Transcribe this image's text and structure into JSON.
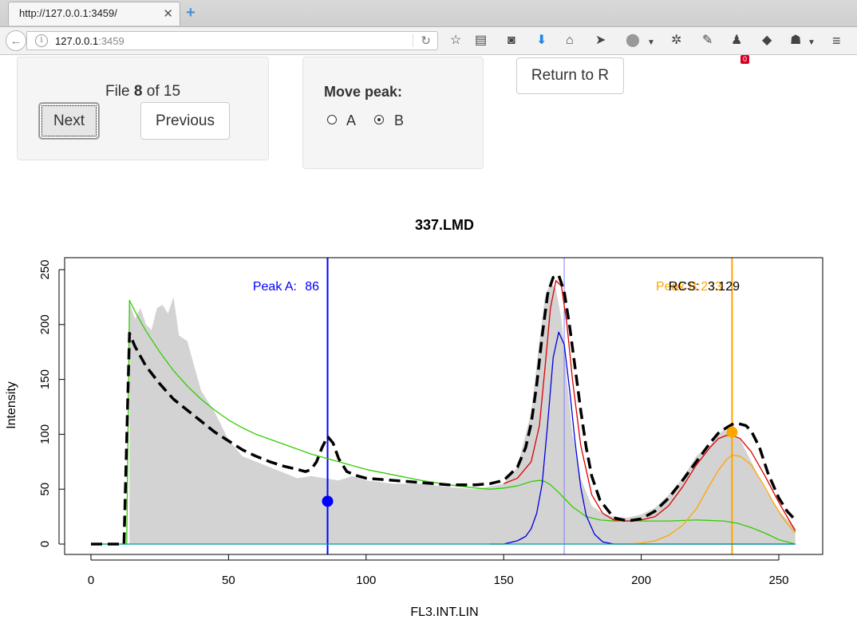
{
  "browser": {
    "tab_title": "http://127.0.0.1:3459/",
    "url_host": "127.0.0.1",
    "url_port": ":3459",
    "notification_count": "0"
  },
  "controls": {
    "file_prefix": "File ",
    "file_current": "8",
    "file_middle": " of ",
    "file_total": "15",
    "next_label": "Next",
    "previous_label": "Previous",
    "move_peak_label": "Move peak:",
    "options": [
      "A",
      "B"
    ],
    "selected_option": "B",
    "return_label": "Return to R"
  },
  "chart_data": {
    "type": "line",
    "title": "337.LMD",
    "xlabel": "FL3.INT.LIN",
    "ylabel": "Intensity",
    "xlim": [
      0,
      256
    ],
    "ylim": [
      0,
      250
    ],
    "xticks": [
      0,
      50,
      100,
      150,
      200,
      250
    ],
    "yticks": [
      0,
      50,
      100,
      150,
      200,
      250
    ],
    "annotations": {
      "peak_a_label": "Peak A:",
      "peak_a_value": "86",
      "peak_b_label": "Peak B:",
      "peak_b_value": "233",
      "rcs_label": "RCS:",
      "rcs_value": "3.129"
    },
    "markers": [
      {
        "name": "Peak A",
        "x": 86,
        "y": 39,
        "color": "#0000ff"
      },
      {
        "name": "Peak B",
        "x": 233,
        "y": 102,
        "color": "#ffa500"
      }
    ],
    "vlines": [
      {
        "x": 86,
        "color": "#0000ff"
      },
      {
        "x": 172,
        "color": "#8080ff"
      },
      {
        "x": 233,
        "color": "#ffa500"
      }
    ],
    "histogram": {
      "color": "#d3d3d3",
      "x": [
        14,
        16,
        18,
        20,
        22,
        24,
        26,
        28,
        30,
        32,
        35,
        40,
        45,
        50,
        55,
        60,
        65,
        70,
        75,
        80,
        85,
        90,
        95,
        100,
        110,
        120,
        130,
        140,
        150,
        155,
        160,
        163,
        165,
        167,
        169,
        171,
        173,
        175,
        178,
        182,
        186,
        190,
        195,
        200,
        205,
        210,
        215,
        220,
        225,
        228,
        230,
        233,
        236,
        240,
        245,
        250,
        256
      ],
      "y": [
        220,
        205,
        215,
        200,
        195,
        215,
        218,
        210,
        225,
        190,
        185,
        140,
        120,
        95,
        80,
        75,
        70,
        65,
        60,
        62,
        60,
        58,
        62,
        58,
        55,
        55,
        52,
        50,
        55,
        70,
        120,
        185,
        225,
        238,
        232,
        205,
        150,
        100,
        60,
        35,
        28,
        25,
        24,
        27,
        33,
        45,
        60,
        80,
        90,
        100,
        104,
        98,
        95,
        75,
        50,
        30,
        15
      ]
    },
    "series": [
      {
        "name": "",
        "color": "#000000",
        "dash": true,
        "x": [
          0,
          12,
          14,
          16,
          20,
          25,
          30,
          35,
          40,
          45,
          50,
          55,
          60,
          65,
          70,
          75,
          78,
          80,
          82,
          84,
          86,
          88,
          90,
          93,
          97,
          100,
          110,
          120,
          130,
          140,
          145,
          150,
          155,
          158,
          160,
          162,
          164,
          166,
          168,
          170,
          172,
          174,
          176,
          178,
          180,
          182,
          185,
          190,
          195,
          200,
          205,
          210,
          215,
          220,
          225,
          228,
          231,
          233,
          235,
          238,
          240,
          243,
          246,
          250,
          253,
          256
        ],
        "y": [
          0,
          0,
          192,
          180,
          162,
          146,
          132,
          122,
          112,
          102,
          94,
          86,
          80,
          75,
          71,
          68,
          66,
          68,
          75,
          88,
          98,
          92,
          78,
          66,
          62,
          60,
          58,
          56,
          54,
          54,
          55,
          58,
          70,
          88,
          110,
          145,
          190,
          228,
          243,
          245,
          230,
          198,
          160,
          122,
          88,
          62,
          40,
          24,
          21,
          23,
          30,
          42,
          58,
          75,
          92,
          101,
          106,
          109,
          110,
          108,
          103,
          88,
          65,
          42,
          30,
          22
        ]
      },
      {
        "name": "",
        "color": "#33cc00",
        "dash": false,
        "x": [
          0,
          12,
          13,
          14,
          16,
          20,
          25,
          30,
          35,
          40,
          45,
          50,
          55,
          60,
          70,
          80,
          90,
          100,
          110,
          120,
          130,
          140,
          145,
          150,
          155,
          160,
          163,
          165,
          167,
          170,
          175,
          180,
          185,
          190,
          200,
          210,
          220,
          230,
          235,
          240,
          245,
          250,
          256
        ],
        "y": [
          0,
          0,
          0,
          222,
          212,
          194,
          175,
          158,
          144,
          132,
          122,
          113,
          106,
          100,
          91,
          82,
          75,
          68,
          63,
          58,
          54,
          51,
          50,
          51,
          53,
          57,
          58,
          57,
          54,
          47,
          34,
          25,
          22,
          21,
          21,
          21,
          22,
          21,
          19,
          15,
          10,
          4,
          0
        ],
        "comment_none": ""
      },
      {
        "name": "",
        "color": "#dd0000",
        "dash": false,
        "x": [
          150,
          155,
          160,
          163,
          165,
          167,
          169,
          171,
          173,
          175,
          178,
          182,
          186,
          190,
          195,
          200,
          205,
          210,
          215,
          220,
          225,
          228,
          231,
          233,
          236,
          240,
          245,
          250,
          256
        ],
        "y": [
          55,
          60,
          75,
          108,
          160,
          215,
          240,
          235,
          200,
          150,
          90,
          45,
          28,
          22,
          21,
          22,
          25,
          35,
          52,
          72,
          88,
          96,
          99,
          99,
          96,
          84,
          62,
          38,
          12
        ]
      },
      {
        "name": "",
        "color": "#0000dd",
        "dash": false,
        "x": [
          145,
          150,
          155,
          158,
          160,
          162,
          164,
          166,
          168,
          170,
          172,
          174,
          176,
          178,
          180,
          183,
          186,
          190,
          256
        ],
        "y": [
          0,
          0,
          3,
          7,
          14,
          28,
          55,
          110,
          170,
          193,
          182,
          140,
          92,
          52,
          26,
          9,
          2,
          0,
          0
        ]
      },
      {
        "name": "",
        "color": "#ffa500",
        "dash": false,
        "x": [
          195,
          200,
          205,
          210,
          215,
          220,
          224,
          228,
          231,
          233,
          236,
          240,
          244,
          248,
          252,
          256
        ],
        "y": [
          0,
          1,
          3,
          8,
          17,
          32,
          50,
          67,
          77,
          81,
          80,
          72,
          56,
          38,
          22,
          10
        ]
      },
      {
        "name": "",
        "color": "#00a0a0",
        "dash": false,
        "x": [
          0,
          256
        ],
        "y": [
          0,
          0
        ]
      }
    ]
  }
}
